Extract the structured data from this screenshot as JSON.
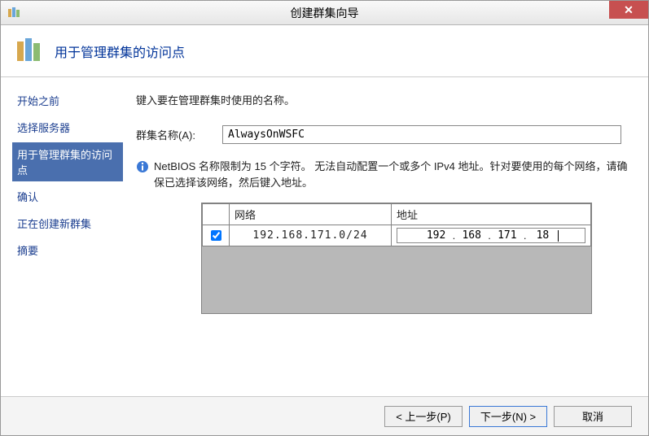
{
  "window": {
    "title": "创建群集向导"
  },
  "header": {
    "title": "用于管理群集的访问点"
  },
  "sidebar": {
    "steps": [
      {
        "label": "开始之前",
        "active": false
      },
      {
        "label": "选择服务器",
        "active": false
      },
      {
        "label": "用于管理群集的访问点",
        "active": true
      },
      {
        "label": "确认",
        "active": false
      },
      {
        "label": "正在创建新群集",
        "active": false
      },
      {
        "label": "摘要",
        "active": false
      }
    ]
  },
  "main": {
    "instruction": "键入要在管理群集时使用的名称。",
    "cluster_name_label": "群集名称(A):",
    "cluster_name_value": "AlwaysOnWSFC",
    "info_text": "NetBIOS 名称限制为 15 个字符。 无法自动配置一个或多个 IPv4 地址。针对要使用的每个网络，请确保已选择该网络，然后键入地址。",
    "table": {
      "headers": {
        "checkbox": "",
        "network": "网络",
        "address": "地址"
      },
      "rows": [
        {
          "checked": true,
          "network": "192.168.171.0/24",
          "address_octets": [
            "192",
            "168",
            "171",
            "18"
          ]
        }
      ]
    }
  },
  "footer": {
    "back": "< 上一步(P)",
    "next": "下一步(N) >",
    "cancel": "取消"
  }
}
